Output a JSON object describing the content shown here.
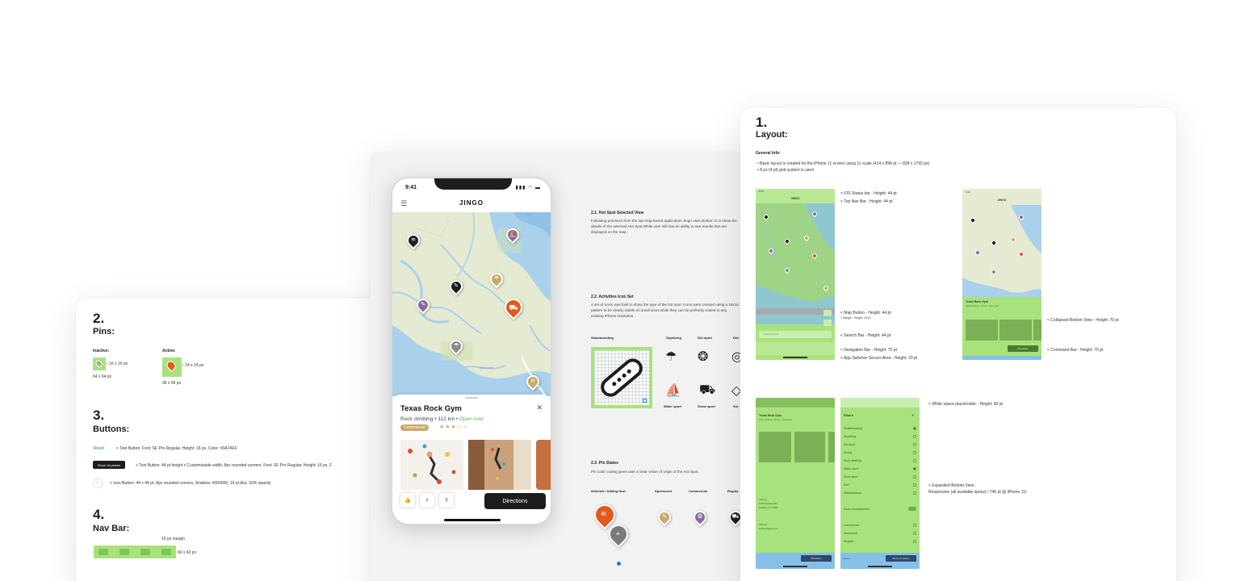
{
  "pins_section": {
    "num": "2.",
    "title": "Pins:",
    "inactive_label": "Inactive:",
    "inactive_size": "16 x 16 px",
    "inactive_frame": "64 x 64 px",
    "active_label": "Active:",
    "active_size": "24 x 24 px",
    "active_frame": "96 x 96 px"
  },
  "buttons_section": {
    "num": "3.",
    "title": "Buttons:",
    "text_button_sample": "Reset",
    "text_button_desc": "< Text Button: Font: SF Pro Regular, Height: 16 px, Color: #0A7AFF",
    "dark_button_sample": "Show 18 places",
    "dark_button_desc": "< Text Button: 44 pt height x Customizable width; 8px rounded corners. Font: SF Pro Regular, Height: 16 px, F",
    "icon_button_desc": "< Icon Button: 44 x 44 pt; 8px rounded corners; Shadow: #000000; 16 pt blur, 16% opacity"
  },
  "navbar_section": {
    "num": "4.",
    "title": "Nav Bar:",
    "margin_note": "16 px margin",
    "size_note": "60 x 42 px"
  },
  "phone": {
    "time": "9:41",
    "status_icons": "▮▮▮ ◠ ▬",
    "brand": "JINGO",
    "map_label_1": "Lake",
    "map_label_2": "Barr\nLake",
    "gym_name": "Texas Rock Gym",
    "gym_meta": "Rock climbing • 112 km • ",
    "gym_open": "Open now",
    "badge": "Commercial",
    "stars": "★★★☆☆",
    "directions": "Directions"
  },
  "hot_spot": {
    "heading": "2.1. Hot Spot Selected View",
    "body": "Following practices from the top-map-based application Jingo uses Bottom S to show the details of the selected Hot Spot While user still has an ability to see results that are displayed on the map."
  },
  "activities": {
    "heading": "2.2. Activities Icon Set",
    "body": "A set of icons was built to show the type of the hot spot. Icons were created using a 16x16 pattern to be clearly visible on small sizes while they can be perfectly scaled to any existing iPhone resolution.",
    "labels": [
      "Skateboarding",
      "Skydiving",
      "Dirt sport",
      "Divi"
    ],
    "labels2": [
      "Water sport",
      "Snow sport",
      "Sur"
    ]
  },
  "pin_states": {
    "heading": "2.3. Pin States",
    "body": "Pin color coding gives user a clear vision of origin of the Hot Spot.",
    "labels": [
      "Selected / Adding New",
      "Sponsored",
      "Commercial",
      "Regula"
    ]
  },
  "layout": {
    "num": "1.",
    "title": "Layout:",
    "general": "General Info:",
    "bullet1": "•  Basic layout is created for the iPhone 11 screen using 1x scale (414 x 896 pt — 828 x 1792 px)",
    "bullet2": "•  8 px (4 pt) grid system is used",
    "annotations": [
      "< iOS Status bar - Height: 44 pt",
      "< Top Nav Bar - Height: 44 pt",
      "< Map Button - Height: 44 pt",
      "< Margin - Height: 16 pt",
      "< Search Bar - Height: 44 pt",
      "< Navigation Bar - Height: 70 pt",
      "< App Switcher Secure Area - Height: 20 pt",
      "< Collapsed Bottom View - Height: 70 pt",
      "< Command Bar - Height: 70 pt",
      "< White space placeholder - Height: 60 pt",
      "< Expanded Bottom View -",
      "   Responsive (all available space) / 746 pt @ iPhone 11)"
    ],
    "mock": {
      "time": "9:41",
      "brand": "JINGO",
      "gym": "Texas Rock Gym",
      "gym_sub": "Rock climbing • 112 km • Open now",
      "directions": "Directions",
      "filters_title": "Filters",
      "filters": [
        "Skateboarding",
        "Skydiving",
        "Dirt sport",
        "Diving",
        "Rock climbing",
        "Water sport",
        "Snow sport",
        "Surf",
        "Miscellaneous"
      ],
      "show_auth": "Show not authorized",
      "origins": [
        "Commercial",
        "Sponsored",
        "Regular"
      ],
      "reset": "Reset",
      "show_places": "Show 18 places",
      "search_placeholder": "Find Hot Spot",
      "address_label": "Address",
      "address_1": "1144 Campion Rd",
      "address_2": "Houston, Tx 77092",
      "website_label": "Website",
      "website": "texasrockgym.com"
    }
  },
  "colors": {
    "accent_green": "#a8e27c",
    "pin_orange": "#e05a1c",
    "pin_black": "#1d1d1f",
    "pin_purple": "#8a6a9a",
    "pin_gold": "#c9a86a",
    "directions_dark": "#1d1d1f",
    "open_green": "#5ab552"
  }
}
